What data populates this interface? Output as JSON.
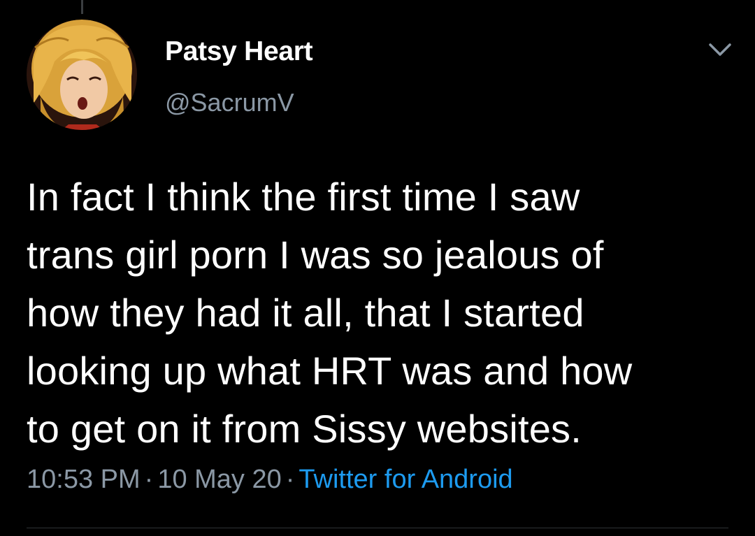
{
  "tweet": {
    "author": {
      "display_name": "Patsy Heart",
      "handle": "@SacrumV",
      "avatar_icon": "anime-girl-avatar"
    },
    "text_lines": [
      "In fact I think the first time I saw",
      "trans girl porn I was so jealous of",
      "how they had it all, that I started",
      "looking up what HRT was and how",
      "to get on it from Sissy websites."
    ],
    "time": "10:53 PM",
    "date": "10 May 20",
    "source": "Twitter for Android",
    "separator": "·",
    "menu_icon": "chevron-down-icon"
  },
  "colors": {
    "background": "#000000",
    "primary_text": "#ffffff",
    "secondary_text": "#8b98a5",
    "link": "#1d9bf0"
  }
}
